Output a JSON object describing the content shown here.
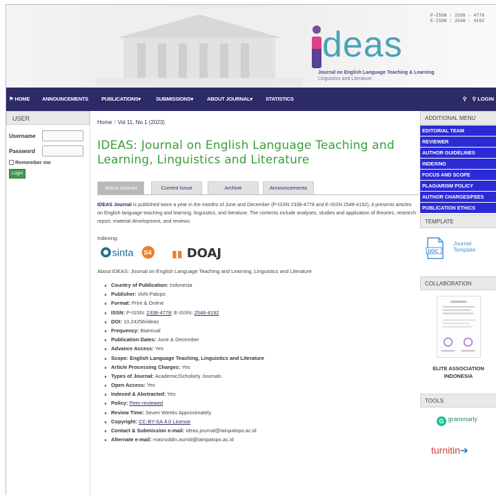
{
  "header": {
    "issn_print": "P-ISSN : 2338 - 4778",
    "issn_online": "E-ISSN : 2548 - 4192",
    "logo_word": "deas",
    "logo_tagline": "Journal on English Language Teaching & Learning",
    "logo_tagline2": "Linguistics and Literature"
  },
  "nav": {
    "items": [
      {
        "icon": "home-icon",
        "label": "HOME"
      },
      {
        "label": "ANNOUNCEMENTS"
      },
      {
        "label": "PUBLICATIONS"
      },
      {
        "label": "SUBMISSIONS"
      },
      {
        "label": "ABOUT JOURNAL"
      },
      {
        "label": "STATISTICS"
      }
    ],
    "search_icon": "search-icon",
    "login_label": "LOGIN"
  },
  "left": {
    "user_head": "USER",
    "username_label": "Username",
    "password_label": "Password",
    "remember_label": "Remember me",
    "login_button": "Login"
  },
  "main": {
    "breadcrumb": [
      "Home",
      "Vol 11, No 1 (2023)"
    ],
    "title": "IDEAS: Journal on English Language Teaching and Learning, Linguistics and Literature",
    "tabs": [
      "About Journal",
      "Current Issue",
      "Archive",
      "Announcements"
    ],
    "about_bold": "IDEAS Journal",
    "about_text": " is published twice a year in the months of June and December (P-ISSN 2338-4778 and E-ISSN 2548-4192), it presents articles on English language teaching and learning, linguistics, and literature. The contents include analyses, studies and application of theories, research report, material development, and reviews.",
    "indexing_label": "Indexing:",
    "sinta_text": "sinta",
    "sinta_badge": "S4",
    "doaj_text": "DOAJ",
    "about_journal_line": "About IDEAS: Journal on English Language Teaching and Learning, Linguistics and Literature",
    "properties": [
      {
        "key": "Country of Publication:",
        "value": " Indonesia"
      },
      {
        "key": "Publisher:",
        "value": " IAIN Palopo"
      },
      {
        "key": "Format:",
        "value": " Print & Online"
      },
      {
        "key": "ISSN:",
        "value": " P-ISSN: ",
        "link1": "2338-4778",
        "mid": "; E-ISSN: ",
        "link2": "2548-4192"
      },
      {
        "key": "DOI:",
        "value": " 10.24256/ideas"
      },
      {
        "key": "Frequency:",
        "value": " Biannual"
      },
      {
        "key": "Publication Dates:",
        "value": " June & December"
      },
      {
        "key": "Advance Access:",
        "value": " Yes"
      },
      {
        "key": "Scope: English Language Teaching, Linguistics and Literature",
        "value": ""
      },
      {
        "key": "Article Processing Charges:",
        "value": " Yes"
      },
      {
        "key": "Types of Journal:",
        "value": " Academic/Scholarly Journals"
      },
      {
        "key": "Open Access:",
        "value": " Yes"
      },
      {
        "key": "Indexed & Abstracted:",
        "value": " Yes"
      },
      {
        "key": "Policy:",
        "value": " ",
        "link1": "Peer-reviewed"
      },
      {
        "key": "Review Time:",
        "value": " Seven Weeks Approximately"
      },
      {
        "key": "Copyright:",
        "value": " ",
        "link1": "CC-BY-SA 4.0 License"
      },
      {
        "key": "Contact & Submission e-mail:",
        "value": " ideas.journal@iainpalopo.ac.id"
      },
      {
        "key": "Alternate e-mail:",
        "value": " masruddin.asmid@iainpalopo.ac.id"
      }
    ]
  },
  "right": {
    "additional_head": "ADDITIONAL MENU",
    "menu": [
      "EDITORIAL TEAM",
      "REVIEWER",
      "AUTHOR GUIDELINES",
      "INDEXING",
      "FOCUS AND SCOPE",
      "PLAGIARISM POLICY",
      "AUTHOR CHARGES/FEES",
      "PUBLICATION ETHICS"
    ],
    "template_head": "TEMPLATE",
    "template_icon_text": "DOC",
    "template_label1": "Journal",
    "template_label2": "Template",
    "collab_head": "COLLABORATION",
    "elite_line1": "ELITE ASSOCIATION",
    "elite_line2": "INDONESIA",
    "tools_head": "TOOLS",
    "grammarly": "grammarly",
    "turnitin": "turnitin"
  },
  "colors": {
    "nav_bg": "#2d2a68",
    "menu_bg": "#2b2bd6",
    "title_green": "#3a9e3a",
    "logo_teal": "#4aa3b5"
  }
}
